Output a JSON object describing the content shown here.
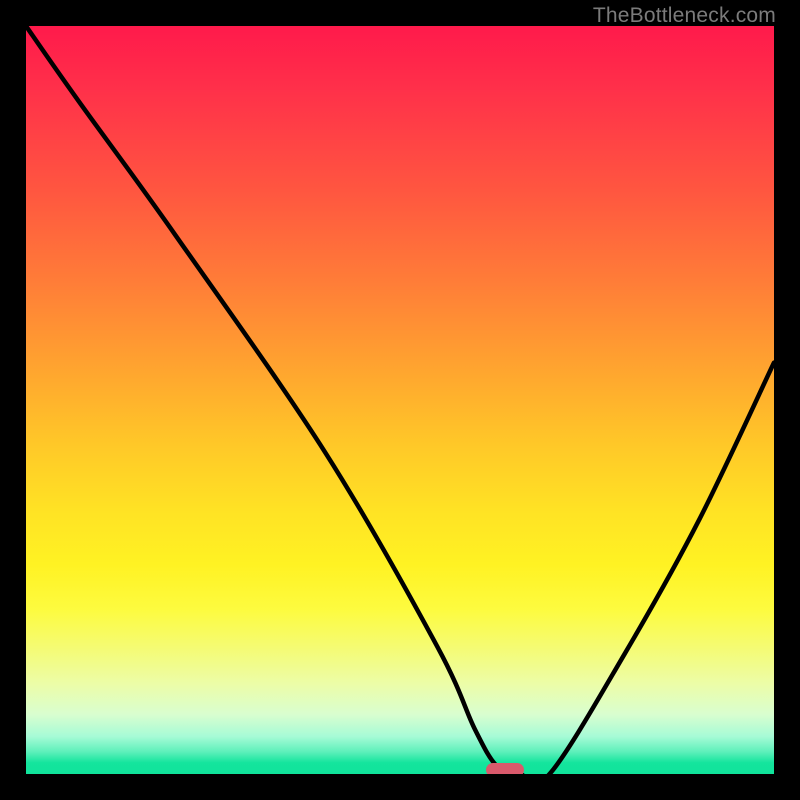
{
  "watermark": "TheBottleneck.com",
  "colors": {
    "curve": "#000000",
    "marker": "#d9596b",
    "page_bg": "#000000"
  },
  "chart_data": {
    "type": "line",
    "title": "",
    "xlabel": "",
    "ylabel": "",
    "xlim": [
      0,
      100
    ],
    "ylim": [
      0,
      100
    ],
    "grid": false,
    "legend": false,
    "x": [
      0,
      7,
      20,
      40,
      55,
      60,
      63,
      66,
      70,
      80,
      90,
      100
    ],
    "values": [
      100,
      90,
      72,
      43,
      17,
      6,
      1,
      0,
      0,
      16,
      34,
      55
    ],
    "marker": {
      "x": 64,
      "y": 0
    },
    "gradient_stops": [
      {
        "pos": 0.0,
        "color": "#ff1a4b"
      },
      {
        "pos": 0.5,
        "color": "#ffc828"
      },
      {
        "pos": 0.8,
        "color": "#f5fb72"
      },
      {
        "pos": 1.0,
        "color": "#10e39b"
      }
    ]
  }
}
